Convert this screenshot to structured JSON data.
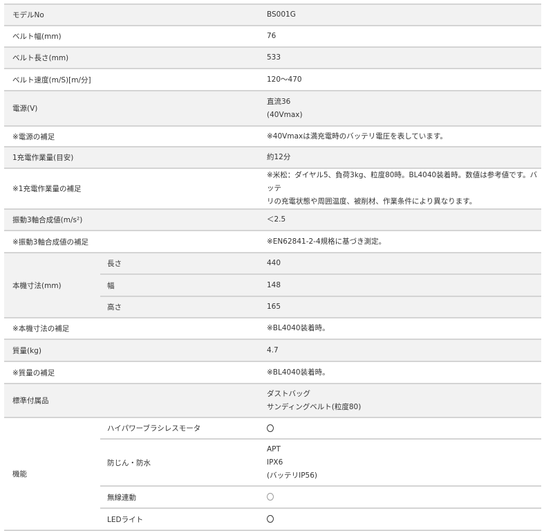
{
  "spec_table": {
    "rows": [
      {
        "label": "モデルNo",
        "value": [
          "BS001G"
        ],
        "h": 31
      },
      {
        "label": "ベルト幅(mm)",
        "value": [
          "76"
        ],
        "h": 31
      },
      {
        "label": "ベルト長さ(mm)",
        "value": [
          "533"
        ],
        "h": 31
      },
      {
        "label": "ベルト速度(m/S)[m/分]",
        "value": [
          "120〜470"
        ],
        "h": 32
      },
      {
        "label": "電源(V)",
        "value": [
          "直流36",
          "(40Vmax)"
        ],
        "h": 51
      },
      {
        "label": "※電源の補足",
        "value": [
          "※40Vmaxは満充電時のバッテリ電圧を表しています。"
        ],
        "h": 30
      },
      {
        "label": "1充電作業量(目安)",
        "value": [
          "約12分"
        ],
        "h": 31
      },
      {
        "label": "※1充電作業量の補足",
        "value": [
          "※米松：ダイヤル5、負荷3kg、粒度80時。BL4040装着時。数値は参考値です。バッテ",
          "リの充電状態や周囲温度、被削材、作業条件により異なります。"
        ],
        "h": 49
      },
      {
        "label": "振動3軸合成値(m/s²)",
        "value": [
          "＜2.5"
        ],
        "h": 31
      },
      {
        "label": "※振動3軸合成値の補足",
        "value": [
          "※EN62841-2-4規格に基づき測定。"
        ],
        "h": 32
      },
      {
        "label": "本機寸法(mm)",
        "subs": [
          {
            "label": "長さ",
            "value": [
              "440"
            ],
            "h": 31
          },
          {
            "label": "幅",
            "value": [
              "148"
            ],
            "h": 32
          },
          {
            "label": "高さ",
            "value": [
              "165"
            ],
            "h": 31
          }
        ]
      },
      {
        "label": "※本機寸法の補足",
        "value": [
          "※BL4040装着時。"
        ],
        "h": 31
      },
      {
        "label": "質量(kg)",
        "value": [
          "4.7"
        ],
        "h": 32
      },
      {
        "label": "※質量の補足",
        "value": [
          "※BL4040装着時。"
        ],
        "h": 32
      },
      {
        "label": "標準付属品",
        "value": [
          "ダストバッグ",
          "サンディングベルト(粒度80)"
        ],
        "h": 49
      },
      {
        "label": "機能",
        "subs": [
          {
            "label": "ハイパワーブラシレスモータ",
            "value": [
              "○"
            ],
            "h": 31,
            "circle": "dark"
          },
          {
            "label": "防じん・防水",
            "value": [
              "APT",
              "IPX6",
              "(バッテリIP56)"
            ],
            "h": 68
          },
          {
            "label": "無線連動",
            "value": [
              "○"
            ],
            "h": 32,
            "circle": "light"
          },
          {
            "label": "LEDライト",
            "value": [
              "○"
            ],
            "h": 32,
            "circle": "dark"
          }
        ]
      }
    ]
  },
  "colors": {
    "gray_row": "#f2f2f2",
    "border": "#d4d4d4",
    "text": "#333333"
  }
}
